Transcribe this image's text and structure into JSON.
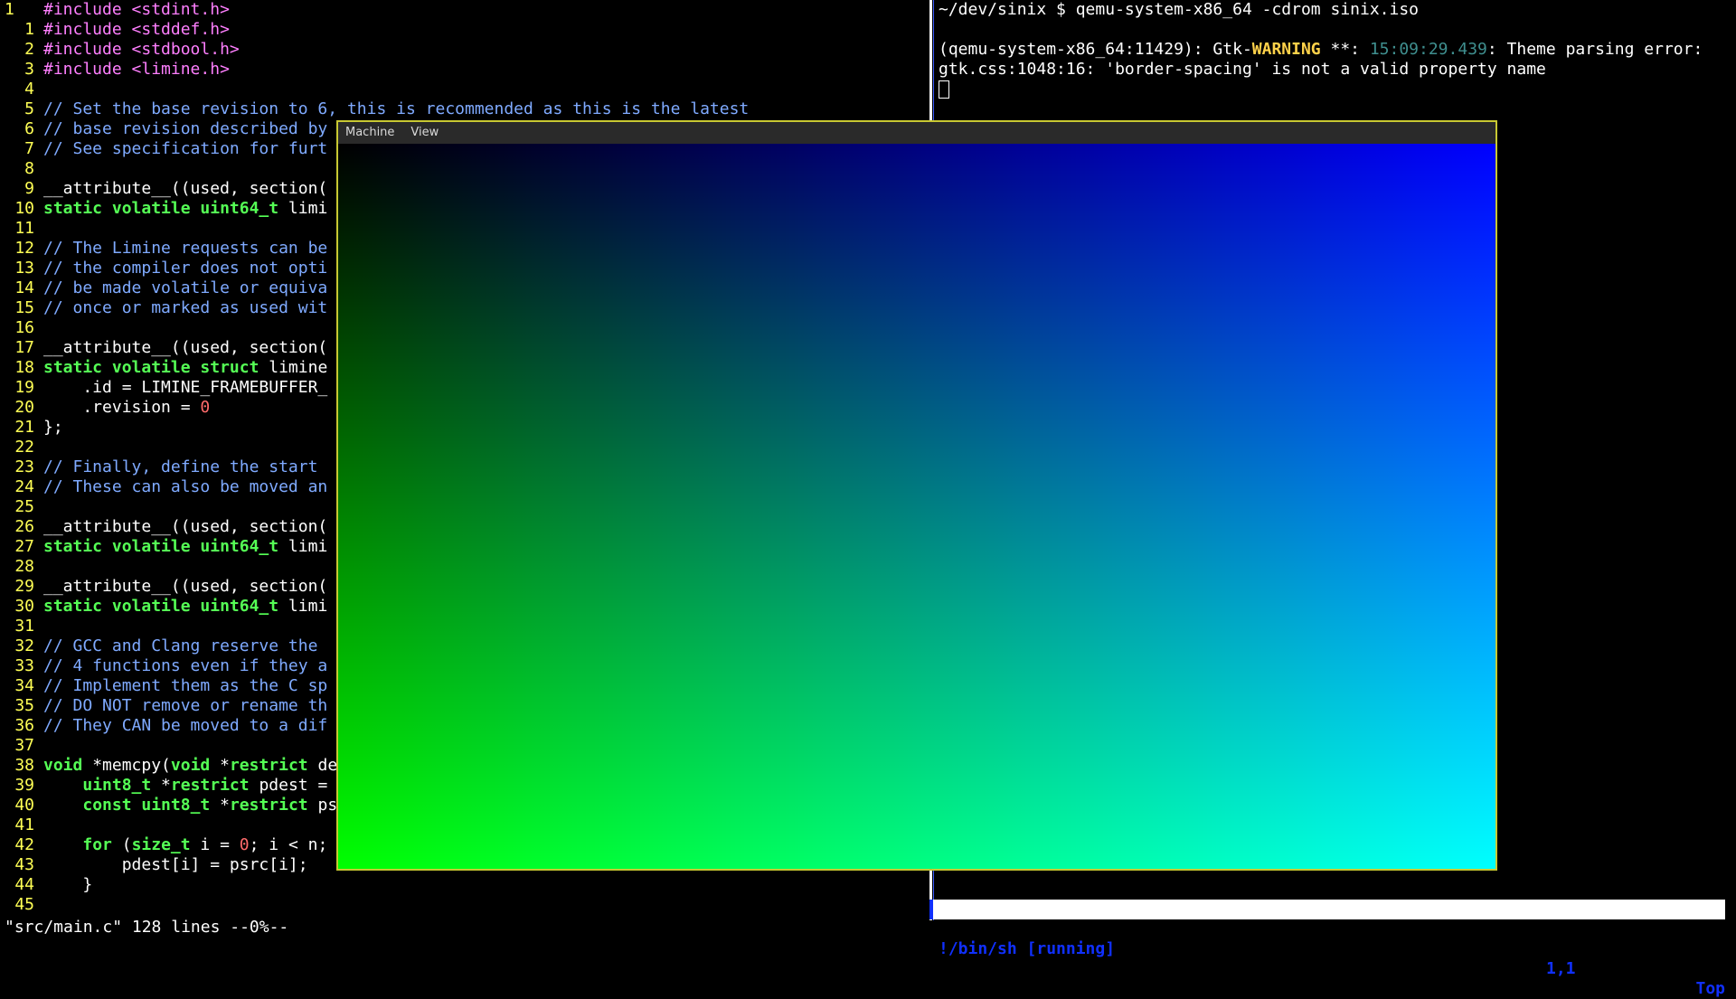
{
  "editor": {
    "filename_status": "\"src/main.c\" 128 lines --0%--",
    "lines": [
      {
        "n": "1",
        "cur": true,
        "tokens": [
          {
            "t": "pre",
            "v": "#include <stdint.h>"
          }
        ]
      },
      {
        "n": "1",
        "tokens": [
          {
            "t": "pre",
            "v": "#include <stddef.h>"
          }
        ]
      },
      {
        "n": "2",
        "tokens": [
          {
            "t": "pre",
            "v": "#include <stdbool.h>"
          }
        ]
      },
      {
        "n": "3",
        "tokens": [
          {
            "t": "pre",
            "v": "#include <limine.h>"
          }
        ]
      },
      {
        "n": "4",
        "tokens": []
      },
      {
        "n": "5",
        "tokens": [
          {
            "t": "com",
            "v": "// Set the base revision to 6, this is recommended as this is the latest"
          }
        ]
      },
      {
        "n": "6",
        "tokens": [
          {
            "t": "com",
            "v": "// base revision described by"
          }
        ]
      },
      {
        "n": "7",
        "tokens": [
          {
            "t": "com",
            "v": "// See specification for furt"
          }
        ]
      },
      {
        "n": "8",
        "tokens": []
      },
      {
        "n": "9",
        "tokens": [
          {
            "t": "txt",
            "v": "__attribute__((used, section("
          }
        ]
      },
      {
        "n": "10",
        "tokens": [
          {
            "t": "kw",
            "v": "static volatile uint64_t"
          },
          {
            "t": "txt",
            "v": " limi"
          }
        ]
      },
      {
        "n": "11",
        "tokens": []
      },
      {
        "n": "12",
        "tokens": [
          {
            "t": "com",
            "v": "// The Limine requests can be"
          }
        ]
      },
      {
        "n": "13",
        "tokens": [
          {
            "t": "com",
            "v": "// the compiler does not opti"
          }
        ]
      },
      {
        "n": "14",
        "tokens": [
          {
            "t": "com",
            "v": "// be made volatile or equiva"
          }
        ]
      },
      {
        "n": "15",
        "tokens": [
          {
            "t": "com",
            "v": "// once or marked as used wit"
          }
        ]
      },
      {
        "n": "16",
        "tokens": []
      },
      {
        "n": "17",
        "tokens": [
          {
            "t": "txt",
            "v": "__attribute__((used, section("
          }
        ]
      },
      {
        "n": "18",
        "tokens": [
          {
            "t": "kw",
            "v": "static volatile struct"
          },
          {
            "t": "txt",
            "v": " limine"
          }
        ]
      },
      {
        "n": "19",
        "tokens": [
          {
            "t": "txt",
            "v": "    .id = LIMINE_FRAMEBUFFER_"
          }
        ]
      },
      {
        "n": "20",
        "tokens": [
          {
            "t": "txt",
            "v": "    .revision = "
          },
          {
            "t": "num",
            "v": "0"
          }
        ]
      },
      {
        "n": "21",
        "tokens": [
          {
            "t": "txt",
            "v": "};"
          }
        ]
      },
      {
        "n": "22",
        "tokens": []
      },
      {
        "n": "23",
        "tokens": [
          {
            "t": "com",
            "v": "// Finally, define the start"
          }
        ]
      },
      {
        "n": "24",
        "tokens": [
          {
            "t": "com",
            "v": "// These can also be moved an"
          }
        ]
      },
      {
        "n": "25",
        "tokens": []
      },
      {
        "n": "26",
        "tokens": [
          {
            "t": "txt",
            "v": "__attribute__((used, section("
          }
        ]
      },
      {
        "n": "27",
        "tokens": [
          {
            "t": "kw",
            "v": "static volatile uint64_t"
          },
          {
            "t": "txt",
            "v": " limi"
          }
        ]
      },
      {
        "n": "28",
        "tokens": []
      },
      {
        "n": "29",
        "tokens": [
          {
            "t": "txt",
            "v": "__attribute__((used, section("
          }
        ]
      },
      {
        "n": "30",
        "tokens": [
          {
            "t": "kw",
            "v": "static volatile uint64_t"
          },
          {
            "t": "txt",
            "v": " limi"
          }
        ]
      },
      {
        "n": "31",
        "tokens": []
      },
      {
        "n": "32",
        "tokens": [
          {
            "t": "com",
            "v": "// GCC and Clang reserve the"
          }
        ]
      },
      {
        "n": "33",
        "tokens": [
          {
            "t": "com",
            "v": "// 4 functions even if they a"
          }
        ]
      },
      {
        "n": "34",
        "tokens": [
          {
            "t": "com",
            "v": "// Implement them as the C sp"
          }
        ]
      },
      {
        "n": "35",
        "tokens": [
          {
            "t": "com",
            "v": "// DO NOT remove or rename th"
          }
        ]
      },
      {
        "n": "36",
        "tokens": [
          {
            "t": "com",
            "v": "// They CAN be moved to a dif"
          }
        ]
      },
      {
        "n": "37",
        "tokens": []
      },
      {
        "n": "38",
        "tokens": [
          {
            "t": "kw",
            "v": "void"
          },
          {
            "t": "txt",
            "v": " *memcpy("
          },
          {
            "t": "kw",
            "v": "void"
          },
          {
            "t": "txt",
            "v": " *"
          },
          {
            "t": "kw",
            "v": "restrict"
          },
          {
            "t": "txt",
            "v": " de"
          }
        ]
      },
      {
        "n": "39",
        "tokens": [
          {
            "t": "txt",
            "v": "    "
          },
          {
            "t": "kw",
            "v": "uint8_t"
          },
          {
            "t": "txt",
            "v": " *"
          },
          {
            "t": "kw",
            "v": "restrict"
          },
          {
            "t": "txt",
            "v": " pdest ="
          }
        ]
      },
      {
        "n": "40",
        "tokens": [
          {
            "t": "txt",
            "v": "    "
          },
          {
            "t": "kw",
            "v": "const uint8_t"
          },
          {
            "t": "txt",
            "v": " *"
          },
          {
            "t": "kw",
            "v": "restrict"
          },
          {
            "t": "txt",
            "v": " ps"
          }
        ]
      },
      {
        "n": "41",
        "tokens": []
      },
      {
        "n": "42",
        "tokens": [
          {
            "t": "txt",
            "v": "    "
          },
          {
            "t": "kw",
            "v": "for"
          },
          {
            "t": "txt",
            "v": " ("
          },
          {
            "t": "kw",
            "v": "size_t"
          },
          {
            "t": "txt",
            "v": " i = "
          },
          {
            "t": "num",
            "v": "0"
          },
          {
            "t": "txt",
            "v": "; i < n;"
          }
        ]
      },
      {
        "n": "43",
        "tokens": [
          {
            "t": "txt",
            "v": "        pdest[i] = psrc[i];"
          }
        ]
      },
      {
        "n": "44",
        "tokens": [
          {
            "t": "txt",
            "v": "    }"
          }
        ]
      },
      {
        "n": "45",
        "tokens": []
      }
    ]
  },
  "terminal": {
    "prompt_line": "~/dev/sinix $ qemu-system-x86_64 -cdrom sinix.iso",
    "warning_prefix": "(qemu-system-x86_64:11429): Gtk-",
    "warning_word": "WARNING",
    "warning_stars": " **: ",
    "warning_time": "15:09:29.439",
    "warning_msg": ": Theme parsing error:",
    "warning_line2": "gtk.css:1048:16: 'border-spacing' is not a valid property name",
    "status_name": "!/bin/sh [running]",
    "status_pos": "1,1",
    "status_scroll": "Top"
  },
  "qemu": {
    "menu": [
      "Machine",
      "View"
    ],
    "gradient_colors": {
      "top_left": "#000000",
      "top_right": "#0000ff",
      "bottom_left": "#00ff00",
      "bottom_right": "#00ffff"
    }
  }
}
